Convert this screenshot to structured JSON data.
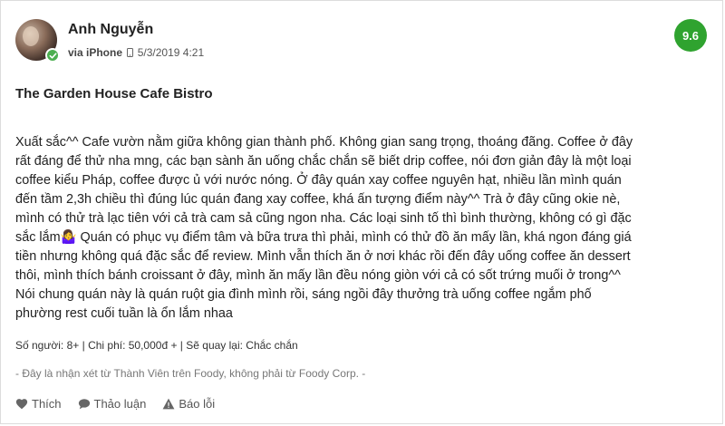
{
  "review": {
    "user_name": "Anh Nguyễn",
    "device": "via iPhone",
    "device_icon": "phone-icon",
    "date": "5/3/2019 4:21",
    "score": "9.6",
    "score_color": "#2fa32f",
    "title": "The Garden House Cafe Bistro",
    "body_lines": [
      "Xuất sắc^^ Cafe vườn nằm giữa không gian thành phố. Không gian sang trọng, thoáng đãng. Coffee ở đây",
      "rất đáng để thử nha mng, các bạn sành ăn uống chắc chắn sẽ biết drip coffee, nói đơn giản đây là một loại",
      "coffee kiểu Pháp, coffee được ủ với nước nóng. Ở đây quán xay coffee nguyên hạt, nhiều lần mình quán",
      "đến tầm 2,3h chiều thì đúng lúc quán đang xay coffee, khá ấn tượng điểm này^^ Trà ở đây cũng okie nè,",
      "mình có thử trà lạc tiên với cả trà cam sả cũng ngon nha. Các loại sinh tố thì bình thường, không có gì đặc",
      "sắc lắm🤷‍♀️ Quán có phục vụ điểm tâm và bữa trưa thì phải, mình có thử đồ ăn mấy lần, khá ngon đáng giá",
      "tiền nhưng không quá đặc sắc để review. Mình vẫn thích ăn ở nơi khác rồi đến đây uống coffee ăn dessert",
      "thôi, mình thích bánh croissant ở đây, mình ăn mấy lần đều nóng giòn với cả có sốt trứng muối ở trong^^",
      "Nói chung quán này là quán ruột gia đình mình rồi, sáng ngồi đây thưởng trà uống coffee ngắm phố",
      "phường rest cuối tuần là ổn lắm nhaa"
    ],
    "info_line": "Số người: 8+ | Chi phí: 50,000đ + | Sẽ quay lại: Chắc chắn",
    "disclaimer": "- Đây là nhận xét từ Thành Viên trên Foody, không phải từ Foody Corp. -"
  },
  "actions": {
    "like_label": "Thích",
    "like_icon": "heart-icon",
    "discuss_label": "Thảo luận",
    "discuss_icon": "comment-icon",
    "report_label": "Báo lỗi",
    "report_icon": "warning-icon"
  },
  "colors": {
    "verified": "#4caf50"
  }
}
